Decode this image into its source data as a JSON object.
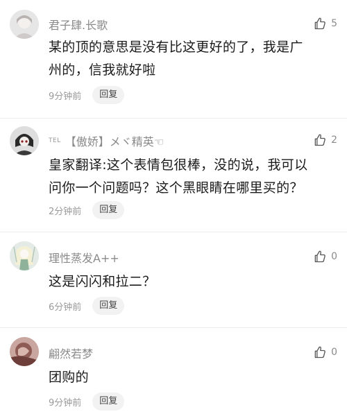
{
  "comments": [
    {
      "username": "君子肆.长歌",
      "tag": "",
      "likes": "5",
      "text_lines": [
        "某的顶的意思是没有比这更好的了，我是广",
        "州的，信我就好啦"
      ],
      "time": "9分钟前",
      "reply_label": "回复"
    },
    {
      "username": "【傲娇】メヾ精英☜",
      "tag": "TEL",
      "likes": "2",
      "text_lines": [
        "皇家翻译:这个表情包很棒，没的说，我可以",
        "问你一个问题吗？这个黑眼睛在哪里买的？"
      ],
      "time": "2分钟前",
      "reply_label": "回复"
    },
    {
      "username": "理性蒸发A++",
      "tag": "",
      "likes": "0",
      "text_lines": [
        "这是闪闪和拉二？"
      ],
      "time": "6分钟前",
      "reply_label": "回复"
    },
    {
      "username": "翩然若梦",
      "tag": "",
      "likes": "0",
      "text_lines": [
        "团购的"
      ],
      "time": "9分钟前",
      "reply_label": "回复"
    }
  ],
  "colors": {
    "username": "#8a8a8a",
    "text": "#1a1a1a",
    "meta": "#999999",
    "reply_bg": "#f2f2f2",
    "divider": "#ececec"
  },
  "icons": {
    "like": "thumbs-up-outline-icon"
  }
}
